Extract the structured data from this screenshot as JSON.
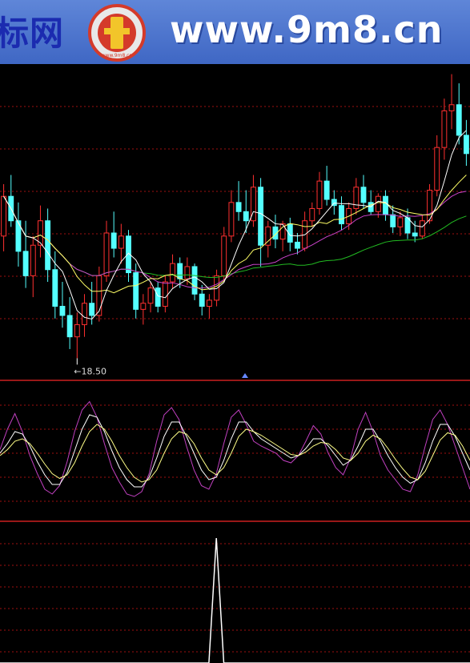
{
  "banner": {
    "site_cn": "标网",
    "logo_text": "www.9m8.cn",
    "url": "www.9m8.cn",
    "bg_color": "#4a72cc"
  },
  "chart_data": [
    {
      "type": "candlestick",
      "title": "",
      "low_label": "18.50",
      "colors": {
        "up": "#ff3030",
        "down": "#54ffff",
        "ma5": "#ffffff",
        "ma10": "#ffff66",
        "ma30": "#cc44cc",
        "ma60": "#22bb22",
        "grid": "#a01010"
      },
      "candles": [
        [
          22.5,
          24.2,
          22.0,
          23.8
        ],
        [
          23.8,
          24.5,
          22.8,
          23.0
        ],
        [
          23.0,
          23.6,
          21.5,
          22.0
        ],
        [
          22.0,
          23.0,
          20.8,
          21.2
        ],
        [
          21.2,
          22.5,
          20.5,
          22.2
        ],
        [
          22.2,
          23.5,
          21.8,
          23.0
        ],
        [
          23.0,
          23.4,
          21.0,
          21.4
        ],
        [
          21.4,
          22.0,
          19.8,
          20.2
        ],
        [
          20.2,
          21.0,
          19.5,
          19.9
        ],
        [
          19.9,
          20.5,
          18.8,
          19.2
        ],
        [
          19.2,
          20.0,
          18.5,
          19.6
        ],
        [
          19.6,
          20.6,
          19.2,
          20.3
        ],
        [
          20.3,
          21.0,
          19.6,
          19.9
        ],
        [
          19.9,
          21.5,
          19.7,
          21.2
        ],
        [
          21.2,
          23.0,
          21.0,
          22.6
        ],
        [
          22.6,
          23.3,
          21.8,
          22.1
        ],
        [
          22.1,
          22.9,
          21.6,
          22.5
        ],
        [
          22.5,
          22.7,
          21.0,
          21.3
        ],
        [
          21.3,
          21.6,
          19.8,
          20.1
        ],
        [
          20.1,
          20.6,
          19.6,
          20.3
        ],
        [
          20.3,
          21.0,
          20.0,
          20.8
        ],
        [
          20.8,
          21.0,
          20.0,
          20.2
        ],
        [
          20.2,
          21.2,
          20.0,
          21.0
        ],
        [
          21.0,
          21.9,
          20.8,
          21.6
        ],
        [
          21.6,
          21.8,
          20.8,
          21.1
        ],
        [
          21.1,
          21.8,
          20.9,
          21.5
        ],
        [
          21.5,
          21.6,
          20.4,
          20.6
        ],
        [
          20.6,
          20.9,
          19.9,
          20.2
        ],
        [
          20.2,
          20.6,
          19.8,
          20.4
        ],
        [
          20.4,
          21.4,
          20.2,
          21.2
        ],
        [
          21.2,
          22.8,
          21.0,
          22.5
        ],
        [
          22.5,
          24.0,
          22.3,
          23.6
        ],
        [
          23.6,
          24.3,
          23.0,
          23.3
        ],
        [
          23.3,
          24.0,
          22.6,
          23.0
        ],
        [
          23.0,
          24.5,
          22.8,
          24.1
        ],
        [
          24.1,
          24.4,
          21.5,
          22.2
        ],
        [
          22.2,
          23.0,
          21.8,
          22.8
        ],
        [
          22.8,
          23.2,
          22.1,
          22.4
        ],
        [
          22.4,
          23.0,
          22.0,
          22.9
        ],
        [
          22.9,
          23.1,
          22.0,
          22.3
        ],
        [
          22.3,
          22.6,
          21.9,
          22.1
        ],
        [
          22.1,
          23.3,
          22.0,
          23.0
        ],
        [
          23.0,
          23.6,
          22.8,
          23.4
        ],
        [
          23.4,
          24.6,
          23.2,
          24.3
        ],
        [
          24.3,
          24.8,
          23.5,
          23.7
        ],
        [
          23.7,
          24.0,
          23.2,
          23.5
        ],
        [
          23.5,
          23.8,
          22.7,
          22.9
        ],
        [
          22.9,
          23.6,
          22.7,
          23.4
        ],
        [
          23.4,
          24.4,
          23.2,
          24.1
        ],
        [
          24.1,
          24.5,
          23.4,
          23.6
        ],
        [
          23.6,
          24.0,
          23.2,
          23.3
        ],
        [
          23.3,
          23.9,
          23.1,
          23.8
        ],
        [
          23.8,
          24.0,
          23.0,
          23.2
        ],
        [
          23.2,
          23.5,
          22.6,
          22.8
        ],
        [
          22.8,
          23.3,
          22.5,
          23.1
        ],
        [
          23.1,
          23.4,
          22.4,
          22.6
        ],
        [
          22.6,
          23.0,
          22.3,
          22.5
        ],
        [
          22.5,
          23.2,
          22.4,
          23.0
        ],
        [
          23.0,
          24.2,
          22.9,
          24.0
        ],
        [
          24.0,
          25.8,
          23.8,
          25.4
        ],
        [
          25.4,
          27.0,
          25.0,
          26.6
        ],
        [
          26.6,
          27.8,
          26.0,
          26.8
        ],
        [
          26.8,
          27.5,
          25.5,
          25.8
        ],
        [
          25.8,
          26.3,
          24.8,
          25.2
        ]
      ]
    },
    {
      "type": "line",
      "title": "",
      "series": [
        {
          "color": "#c040c0",
          "values": [
            55,
            72,
            85,
            70,
            50,
            35,
            22,
            18,
            25,
            45,
            70,
            88,
            95,
            82,
            60,
            40,
            28,
            18,
            16,
            20,
            35,
            62,
            84,
            90,
            80,
            58,
            38,
            25,
            22,
            35,
            60,
            82,
            88,
            76,
            62,
            58,
            55,
            52,
            46,
            44,
            50,
            62,
            75,
            68,
            52,
            40,
            34,
            48,
            72,
            86,
            70,
            50,
            38,
            30,
            22,
            20,
            34,
            58,
            80,
            88,
            76,
            58,
            40,
            22
          ]
        },
        {
          "color": "#ffffff",
          "values": [
            52,
            60,
            70,
            68,
            58,
            45,
            34,
            26,
            26,
            36,
            54,
            72,
            84,
            82,
            70,
            54,
            40,
            30,
            24,
            24,
            32,
            48,
            66,
            78,
            78,
            66,
            52,
            38,
            30,
            32,
            46,
            64,
            78,
            78,
            70,
            64,
            60,
            56,
            52,
            48,
            50,
            56,
            64,
            64,
            58,
            50,
            42,
            46,
            58,
            72,
            72,
            62,
            50,
            40,
            32,
            27,
            30,
            44,
            62,
            76,
            76,
            66,
            52,
            38
          ]
        },
        {
          "color": "#ffff88",
          "values": [
            50,
            55,
            62,
            64,
            60,
            52,
            43,
            35,
            31,
            34,
            44,
            58,
            70,
            76,
            72,
            62,
            50,
            40,
            32,
            28,
            30,
            38,
            52,
            64,
            70,
            68,
            60,
            48,
            38,
            34,
            40,
            52,
            66,
            72,
            70,
            67,
            63,
            59,
            55,
            51,
            50,
            53,
            58,
            61,
            60,
            55,
            48,
            46,
            52,
            62,
            67,
            64,
            56,
            47,
            39,
            32,
            30,
            37,
            50,
            63,
            69,
            67,
            58,
            46
          ]
        }
      ]
    },
    {
      "type": "line",
      "title": "",
      "series": [
        {
          "color": "#ffffff",
          "values": [
            0,
            0,
            0,
            0,
            0,
            0,
            0,
            0,
            0,
            0,
            0,
            0,
            0,
            0,
            0,
            0,
            0,
            0,
            0,
            0,
            0,
            0,
            0,
            0,
            0,
            0,
            0,
            0,
            0,
            100,
            0,
            0,
            0,
            0,
            0,
            0,
            0,
            0,
            0,
            0,
            0,
            0,
            0,
            0,
            0,
            0,
            0,
            0,
            0,
            0,
            0,
            0,
            0,
            0,
            0,
            0,
            0,
            0,
            0,
            0,
            0,
            0,
            0,
            0
          ]
        }
      ]
    }
  ]
}
